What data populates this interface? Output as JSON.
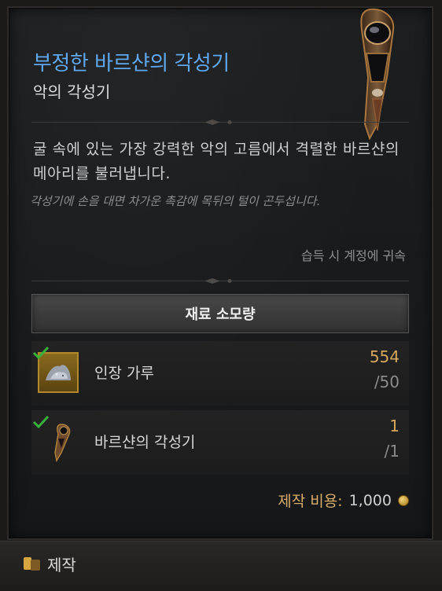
{
  "item": {
    "name": "부정한 바르샨의 각성기",
    "type": "악의 각성기",
    "description": "굴 속에 있는 가장 강력한 악의 고름에서 격렬한 바르샨의 메아리를 불러냅니다.",
    "flavor": "각성기에 손을 대면 차가운 촉감에 목뒤의 털이 곤두섭니다.",
    "binding": "습득 시 계정에 귀속",
    "icon": "varshan-awakener-icon"
  },
  "materials": {
    "header": "재료 소모량",
    "items": [
      {
        "name": "인장 가루",
        "have": "554",
        "need": "/50",
        "icon": "sigil-powder-icon",
        "met": true
      },
      {
        "name": "바르샨의 각성기",
        "have": "1",
        "need": "/1",
        "icon": "varshan-awakener-icon",
        "met": true
      }
    ]
  },
  "cost": {
    "label": "제작 비용:",
    "amount": "1,000",
    "icon": "gold-coin-icon"
  },
  "footer": {
    "tab_label": "제작",
    "tab_icon": "craft-icon"
  },
  "colors": {
    "title": "#5fa8ef",
    "have_amount": "#d6a75c",
    "check": "#39b13a"
  }
}
